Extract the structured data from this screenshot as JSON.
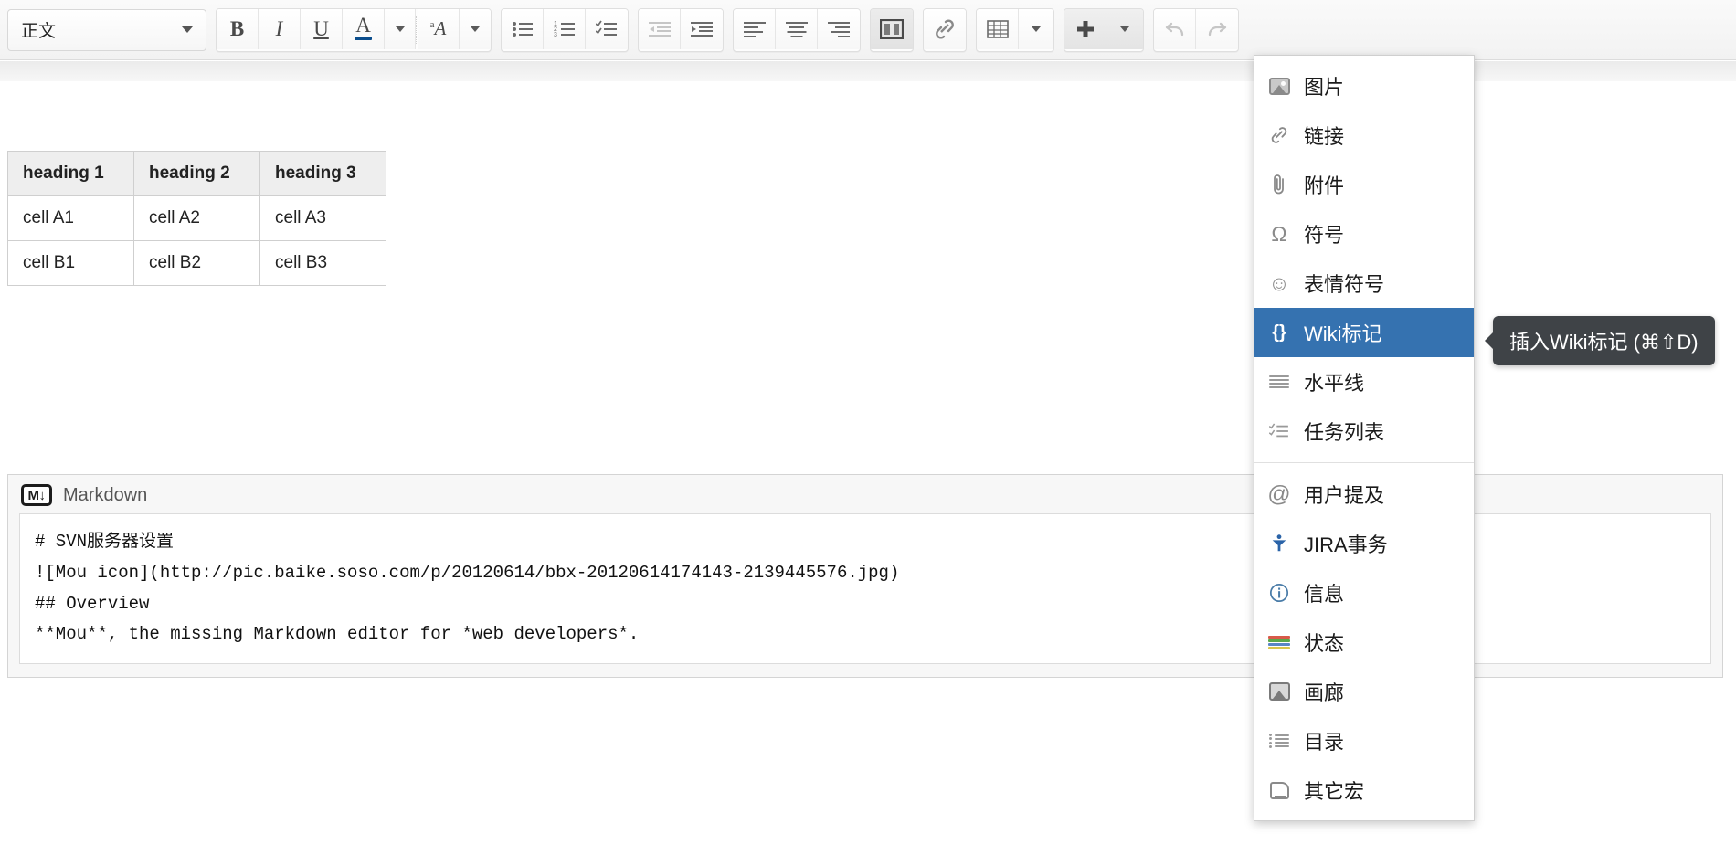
{
  "toolbar": {
    "style_select": {
      "value": "正文",
      "name": "paragraph-style-select"
    },
    "groups": [
      {
        "name": "text-format",
        "buttons": [
          {
            "name": "bold-button",
            "icon": "bold",
            "label": "B",
            "state": "enabled"
          },
          {
            "name": "italic-button",
            "icon": "italic",
            "label": "I",
            "state": "enabled"
          },
          {
            "name": "underline-button",
            "icon": "underline",
            "label": "U",
            "state": "enabled"
          },
          {
            "name": "text-color-button",
            "icon": "text-color",
            "label": "A",
            "state": "enabled"
          },
          {
            "name": "text-color-dropdown",
            "icon": "chevron-down",
            "label": "",
            "state": "enabled"
          },
          {
            "name": "more-format-button",
            "icon": "strike-format",
            "label": "A",
            "state": "enabled"
          },
          {
            "name": "more-format-dropdown",
            "icon": "chevron-down",
            "label": "",
            "state": "enabled"
          }
        ]
      },
      {
        "name": "lists",
        "buttons": [
          {
            "name": "bullet-list-button",
            "icon": "bullet-list",
            "state": "enabled"
          },
          {
            "name": "numbered-list-button",
            "icon": "numbered-list",
            "state": "enabled"
          },
          {
            "name": "task-list-button",
            "icon": "task-list",
            "state": "enabled"
          }
        ]
      },
      {
        "name": "indent",
        "buttons": [
          {
            "name": "outdent-button",
            "icon": "outdent",
            "state": "disabled"
          },
          {
            "name": "indent-button",
            "icon": "indent",
            "state": "enabled"
          }
        ]
      },
      {
        "name": "align",
        "buttons": [
          {
            "name": "align-left-button",
            "icon": "align-left",
            "state": "enabled"
          },
          {
            "name": "align-center-button",
            "icon": "align-center",
            "state": "enabled"
          },
          {
            "name": "align-right-button",
            "icon": "align-right",
            "state": "enabled"
          }
        ]
      },
      {
        "name": "layout",
        "buttons": [
          {
            "name": "page-layout-button",
            "icon": "columns",
            "state": "active"
          }
        ]
      },
      {
        "name": "link",
        "buttons": [
          {
            "name": "insert-link-button",
            "icon": "link",
            "state": "enabled"
          }
        ]
      },
      {
        "name": "table",
        "buttons": [
          {
            "name": "insert-table-button",
            "icon": "table",
            "state": "enabled"
          },
          {
            "name": "table-dropdown",
            "icon": "chevron-down",
            "state": "enabled"
          }
        ]
      },
      {
        "name": "insert",
        "buttons": [
          {
            "name": "insert-more-button",
            "icon": "plus",
            "state": "open"
          },
          {
            "name": "insert-more-dropdown",
            "icon": "chevron-down",
            "state": "open"
          }
        ]
      },
      {
        "name": "history",
        "buttons": [
          {
            "name": "undo-button",
            "icon": "undo",
            "state": "disabled"
          },
          {
            "name": "redo-button",
            "icon": "redo",
            "state": "disabled"
          }
        ]
      }
    ]
  },
  "insert_menu": {
    "name": "insert-dropdown-menu",
    "selected_index": 5,
    "items": [
      {
        "label": "图片",
        "icon": "image-icon",
        "group": 1
      },
      {
        "label": "链接",
        "icon": "link-icon",
        "group": 1
      },
      {
        "label": "附件",
        "icon": "paperclip-icon",
        "group": 1
      },
      {
        "label": "符号",
        "icon": "omega-icon",
        "group": 1
      },
      {
        "label": "表情符号",
        "icon": "smiley-icon",
        "group": 1
      },
      {
        "label": "Wiki标记",
        "icon": "braces-icon",
        "group": 1,
        "selected": true
      },
      {
        "label": "水平线",
        "icon": "horizontal-rule-icon",
        "group": 1
      },
      {
        "label": "任务列表",
        "icon": "task-list-icon",
        "group": 1
      },
      {
        "label": "用户提及",
        "icon": "at-mention-icon",
        "group": 2
      },
      {
        "label": "JIRA事务",
        "icon": "jira-icon",
        "group": 2
      },
      {
        "label": "信息",
        "icon": "info-icon",
        "group": 2
      },
      {
        "label": "状态",
        "icon": "status-icon",
        "group": 2
      },
      {
        "label": "画廊",
        "icon": "gallery-icon",
        "group": 2
      },
      {
        "label": "目录",
        "icon": "toc-icon",
        "group": 2
      },
      {
        "label": "其它宏",
        "icon": "macro-icon",
        "group": 2
      }
    ]
  },
  "tooltip": {
    "text": "插入Wiki标记 (⌘⇧D)"
  },
  "content_table": {
    "headers": [
      "heading 1",
      "heading 2",
      "heading 3"
    ],
    "rows": [
      [
        "cell A1",
        "cell A2",
        "cell A3"
      ],
      [
        "cell B1",
        "cell B2",
        "cell B3"
      ]
    ]
  },
  "markdown_macro": {
    "title": "Markdown",
    "icon_label": "M↓",
    "code": "# SVN服务器设置\n![Mou icon](http://pic.baike.soso.com/p/20120614/bbx-20120614174143-2139445576.jpg)\n## Overview\n**Mou**, the missing Markdown editor for *web developers*."
  },
  "colors": {
    "menu_selected_bg": "#3572b0",
    "tooltip_bg": "#3f4347",
    "toolbar_bg": "#f2f2f2",
    "table_header_bg": "#eeeeee",
    "status_bars": [
      "#d85a4a",
      "#5aa84a",
      "#5a86c4",
      "#d8c44a"
    ],
    "jira_blue": "#2a63a8"
  }
}
